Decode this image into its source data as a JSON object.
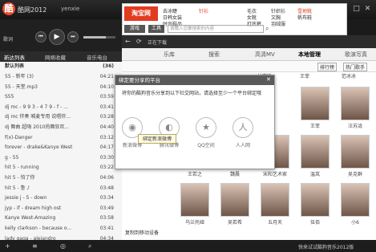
{
  "titlebar": {
    "logo": "酷",
    "app_title": "酷网2012",
    "user": "yenxie",
    "game": "游戏",
    "min": "–",
    "max": "□",
    "close": "✕",
    "menu": "≡"
  },
  "ad": {
    "logo": "淘宝网",
    "cells": [
      "去冰睫",
      "日韩女装",
      "时尚鞋品",
      "针衫",
      "毛衣",
      "女靴",
      "打底裤",
      "针织衫",
      "文胸",
      "羽绒服",
      "雪地靴",
      "帆布鞋"
    ],
    "search_btn": "游戏",
    "tool": "工具",
    "search_placeholder": "请输入您要搜索的内容",
    "icons": [
      "search-icon"
    ]
  },
  "controls": {
    "lyric": "歌词",
    "prev": "⏮",
    "play": "▶",
    "next": "⏭",
    "volume": "音量"
  },
  "left_tabs": [
    "新达列表",
    "网络收藏",
    "音乐电台"
  ],
  "playlist": {
    "header": "默认列表",
    "count": "(36)",
    "rows": [
      {
        "title": "55 - 新年 (3)",
        "time": "04:21"
      },
      {
        "title": "55 - 天堂.mp3",
        "time": "04:10"
      },
      {
        "title": "S55",
        "time": "03:59"
      },
      {
        "title": "dj mc - 9 9 3 - 4 7 9 - f - ...",
        "time": "03:41"
      },
      {
        "title": "dj mc 伴奏 喊麦专用 说唱伴...",
        "time": "03:28"
      },
      {
        "title": "dj 舞曲 超嗨 2010热舞狂欢...",
        "time": "04:40"
      },
      {
        "title": "f(x)-Danger",
        "time": "03:12"
      },
      {
        "title": "forever - drake&Kanye West",
        "time": "04:17"
      },
      {
        "title": "g - 55",
        "time": "03:30"
      },
      {
        "title": "hit 5 - running",
        "time": "03:22"
      },
      {
        "title": "hit 5 - 怕了你",
        "time": "04:06"
      },
      {
        "title": "hit 5 - 鲁 ♪",
        "time": "03:48"
      },
      {
        "title": "jessie j - 5 - down",
        "time": "03:34"
      },
      {
        "title": "jyp - if - dream high ost",
        "time": "03:49"
      },
      {
        "title": "Kanye West-Amazing",
        "time": "03:58"
      },
      {
        "title": "kelly clarkson - because o...",
        "time": "03:41"
      },
      {
        "title": "lady gaga - alejandro",
        "time": "04:34"
      }
    ]
  },
  "main_tabs": [
    "乐库",
    "搜索",
    "高清MV",
    "本地管理",
    "歌演写真"
  ],
  "toolbar": {
    "back": "←",
    "refresh": "⟳",
    "playing": "正在下载",
    "sub_tabs": [
      "排行榜",
      "热门歌手"
    ]
  },
  "artists": {
    "top": [
      "林志玲",
      "王菲",
      "范冰冰"
    ],
    "row1": [
      "王菲",
      "汪苏泷"
    ],
    "row2": [
      "王若之",
      "魏晨",
      "宋和艺术家",
      "温岚",
      "吴克群"
    ],
    "row3": [
      "乌兰托娅",
      "吴若希",
      "五月天",
      "伍佰",
      "小6"
    ]
  },
  "dialog": {
    "title": "绑定要分享的平台",
    "text": "将你的酷狗音乐分享到以下社交网站，请选择至少一个平台绑定哦",
    "tooltip": "绑定新浪微博",
    "platforms": [
      {
        "label": "新浪微博",
        "icon": "weibo-icon",
        "glyph": "◉"
      },
      {
        "label": "腾讯微博",
        "icon": "tencent-weibo-icon",
        "glyph": "◐"
      },
      {
        "label": "QQ空间",
        "icon": "qzone-icon",
        "glyph": "★"
      },
      {
        "label": "人人网",
        "icon": "renren-icon",
        "glyph": "人"
      }
    ],
    "close": "✕"
  },
  "left_pane": {
    "sync": "复制到移动设备"
  },
  "bottom": {
    "text": "快来试试酷狗音乐2012版"
  }
}
